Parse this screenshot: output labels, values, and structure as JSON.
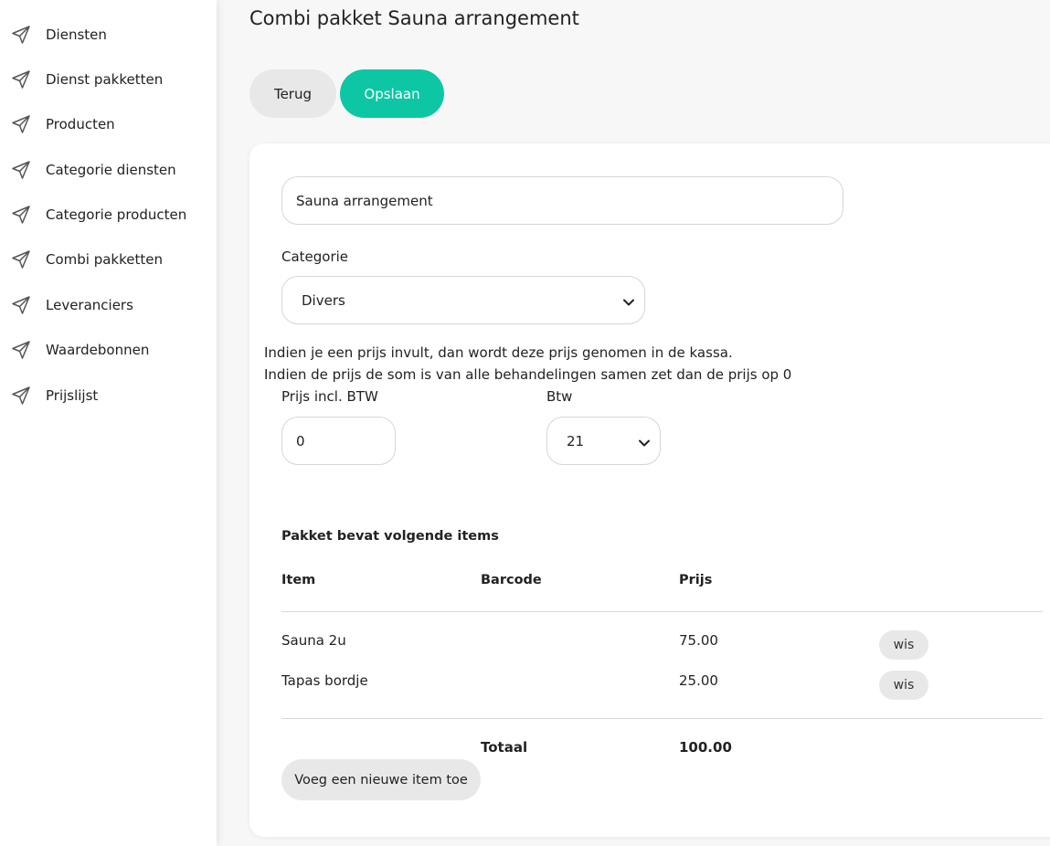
{
  "sidebar": {
    "items": [
      {
        "label": "Diensten",
        "icon": "send-icon"
      },
      {
        "label": "Dienst pakketten",
        "icon": "send-icon"
      },
      {
        "label": "Producten",
        "icon": "send-icon"
      },
      {
        "label": "Categorie diensten",
        "icon": "send-icon"
      },
      {
        "label": "Categorie producten",
        "icon": "send-icon"
      },
      {
        "label": "Combi pakketten",
        "icon": "send-icon"
      },
      {
        "label": "Leveranciers",
        "icon": "send-icon"
      },
      {
        "label": "Waardebonnen",
        "icon": "send-icon"
      },
      {
        "label": "Prijslijst",
        "icon": "send-icon"
      }
    ]
  },
  "header": {
    "title": "Combi pakket Sauna arrangement"
  },
  "toolbar": {
    "back_label": "Terug",
    "save_label": "Opslaan"
  },
  "form": {
    "name_value": "Sauna arrangement",
    "category_label": "Categorie",
    "category_value": "Divers",
    "info_line1": "Indien je een prijs invult, dan wordt deze prijs genomen in de kassa.",
    "info_line2": "Indien de prijs de som is van alle behandelingen samen zet dan de prijs op 0",
    "price_label": "Prijs incl. BTW",
    "price_value": "0",
    "btw_label": "Btw",
    "btw_value": "21"
  },
  "items_table": {
    "title": "Pakket bevat volgende items",
    "headers": {
      "item": "Item",
      "barcode": "Barcode",
      "price": "Prijs"
    },
    "rows": [
      {
        "item": "Sauna 2u",
        "barcode": "",
        "price": "75.00",
        "action": "wis"
      },
      {
        "item": "Tapas bordje",
        "barcode": "",
        "price": "25.00",
        "action": "wis"
      }
    ],
    "total_label": "Totaal",
    "total_value": "100.00",
    "add_label": "Voeg een nieuwe item toe"
  },
  "colors": {
    "accent": "#0dc7a4",
    "button_gray": "#e8e8e8",
    "background": "#f7f7f7"
  }
}
